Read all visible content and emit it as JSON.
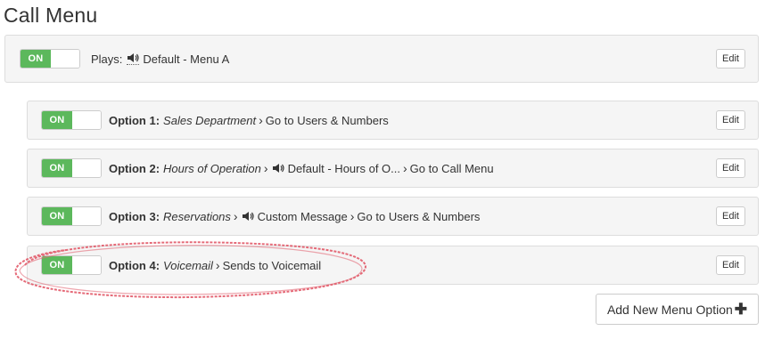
{
  "page": {
    "title": "Call Menu"
  },
  "main_menu": {
    "toggle_label": "ON",
    "plays_label": "Plays:",
    "greeting": "Default - Menu A",
    "edit_label": "Edit"
  },
  "options": [
    {
      "toggle_label": "ON",
      "label": "Option 1:",
      "name": "Sales Department",
      "message": "",
      "action": "Go to Users & Numbers",
      "edit_label": "Edit"
    },
    {
      "toggle_label": "ON",
      "label": "Option 2:",
      "name": "Hours of Operation",
      "message": "Default - Hours of O...",
      "action": "Go to Call Menu",
      "edit_label": "Edit"
    },
    {
      "toggle_label": "ON",
      "label": "Option 3:",
      "name": "Reservations",
      "message": "Custom Message",
      "action": "Go to Users & Numbers",
      "edit_label": "Edit"
    },
    {
      "toggle_label": "ON",
      "label": "Option 4:",
      "name": "Voicemail",
      "message": "",
      "action": "Sends to Voicemail",
      "edit_label": "Edit"
    }
  ],
  "add_button": {
    "label": "Add New Menu Option",
    "icon": "plus-icon"
  },
  "icons": {
    "audio": "speaker-icon",
    "separator": "chevron-right-icon"
  },
  "colors": {
    "toggle_on": "#5cb85c",
    "panel_bg": "#f5f5f5",
    "highlight": "#e05060"
  }
}
